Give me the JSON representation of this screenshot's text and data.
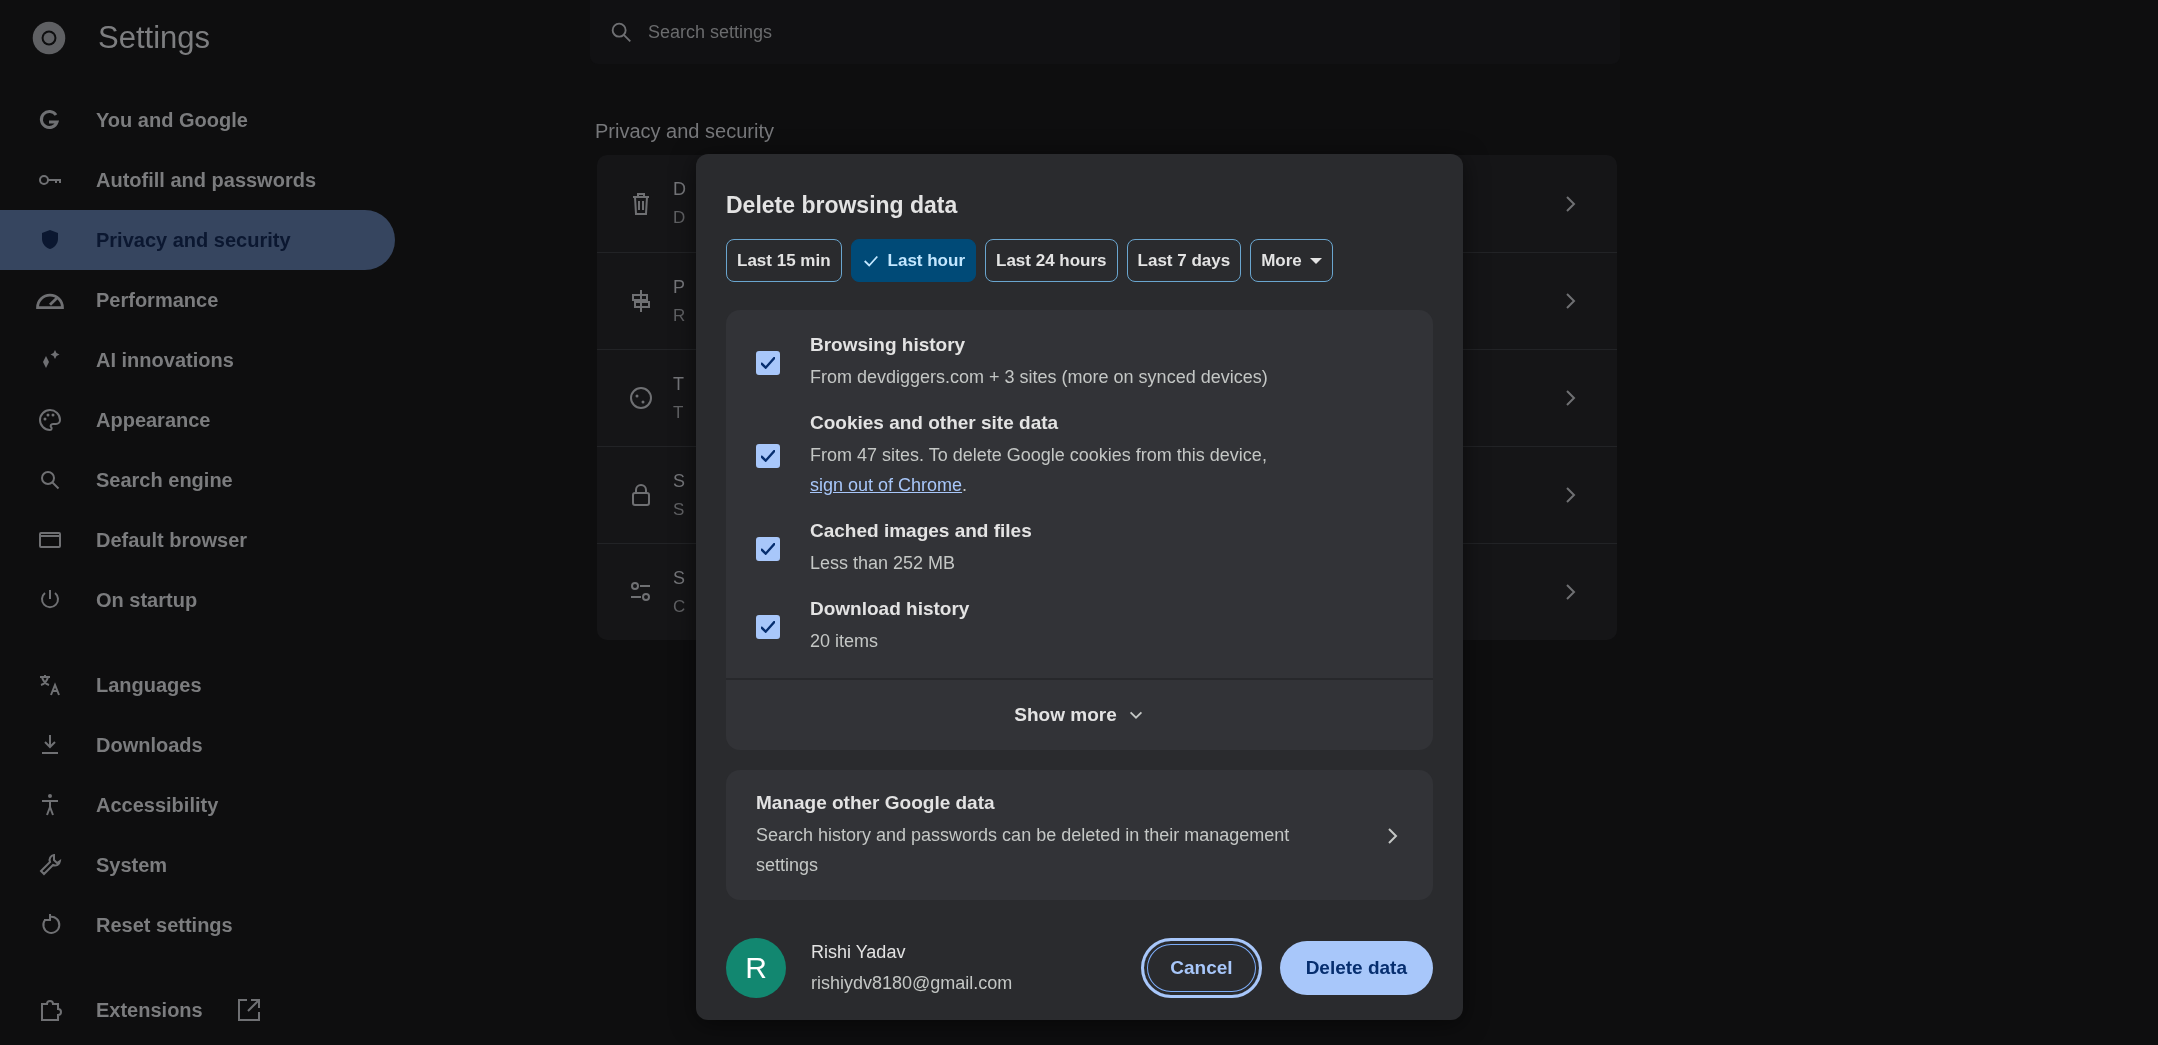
{
  "app": {
    "title": "Settings"
  },
  "sidebar": {
    "groups": [
      [
        {
          "label": "You and Google",
          "selected": false,
          "kind": "page"
        },
        {
          "label": "Autofill and passwords",
          "selected": false,
          "kind": "page"
        },
        {
          "label": "Privacy and security",
          "selected": true,
          "kind": "page"
        },
        {
          "label": "Performance",
          "selected": false,
          "kind": "page"
        },
        {
          "label": "AI innovations",
          "selected": false,
          "kind": "page"
        },
        {
          "label": "Appearance",
          "selected": false,
          "kind": "page"
        },
        {
          "label": "Search engine",
          "selected": false,
          "kind": "page"
        },
        {
          "label": "Default browser",
          "selected": false,
          "kind": "page"
        },
        {
          "label": "On startup",
          "selected": false,
          "kind": "page"
        }
      ],
      [
        {
          "label": "Languages",
          "selected": false,
          "kind": "page"
        },
        {
          "label": "Downloads",
          "selected": false,
          "kind": "page"
        },
        {
          "label": "Accessibility",
          "selected": false,
          "kind": "page"
        },
        {
          "label": "System",
          "selected": false,
          "kind": "page"
        },
        {
          "label": "Reset settings",
          "selected": false,
          "kind": "page"
        }
      ],
      [
        {
          "label": "Extensions",
          "selected": false,
          "kind": "external"
        }
      ]
    ]
  },
  "search": {
    "placeholder": "Search settings"
  },
  "section": {
    "heading": "Privacy and security",
    "rows": [
      {
        "title": "D",
        "subtitle": "D"
      },
      {
        "title": "P",
        "subtitle": "R"
      },
      {
        "title": "T",
        "subtitle": "T"
      },
      {
        "title": "S",
        "subtitle": "S"
      },
      {
        "title": "S",
        "subtitle": "C"
      }
    ]
  },
  "dialog": {
    "title": "Delete browsing data",
    "ranges": [
      {
        "label": "Last 15 min",
        "selected": false,
        "kind": "chip"
      },
      {
        "label": "Last hour",
        "selected": true,
        "kind": "chip"
      },
      {
        "label": "Last 24 hours",
        "selected": false,
        "kind": "chip"
      },
      {
        "label": "Last 7 days",
        "selected": false,
        "kind": "chip"
      },
      {
        "label": "More",
        "selected": false,
        "kind": "dropdown"
      }
    ],
    "items": [
      {
        "title": "Browsing history",
        "description": "From devdiggers.com + 3 sites (more on synced devices)",
        "checked": true
      },
      {
        "title": "Cookies and other site data",
        "description": "From 47 sites. To delete Google cookies from this device, ",
        "link": "sign out of Chrome",
        "description_end": ".",
        "checked": true
      },
      {
        "title": "Cached images and files",
        "description": "Less than 252 MB",
        "checked": true
      },
      {
        "title": "Download history",
        "description": "20 items",
        "checked": true
      }
    ],
    "show_more": {
      "label": "Show more"
    },
    "manage": {
      "title": "Manage other Google data",
      "description": "Search history and passwords can be deleted in their management settings"
    },
    "account": {
      "initial": "R",
      "name": "Rishi Yadav",
      "email": "rishiydv8180@gmail.com"
    },
    "buttons": [
      {
        "label": "Cancel",
        "kind": "secondary",
        "focused": true
      },
      {
        "label": "Delete data",
        "kind": "primary",
        "focused": false
      }
    ]
  }
}
